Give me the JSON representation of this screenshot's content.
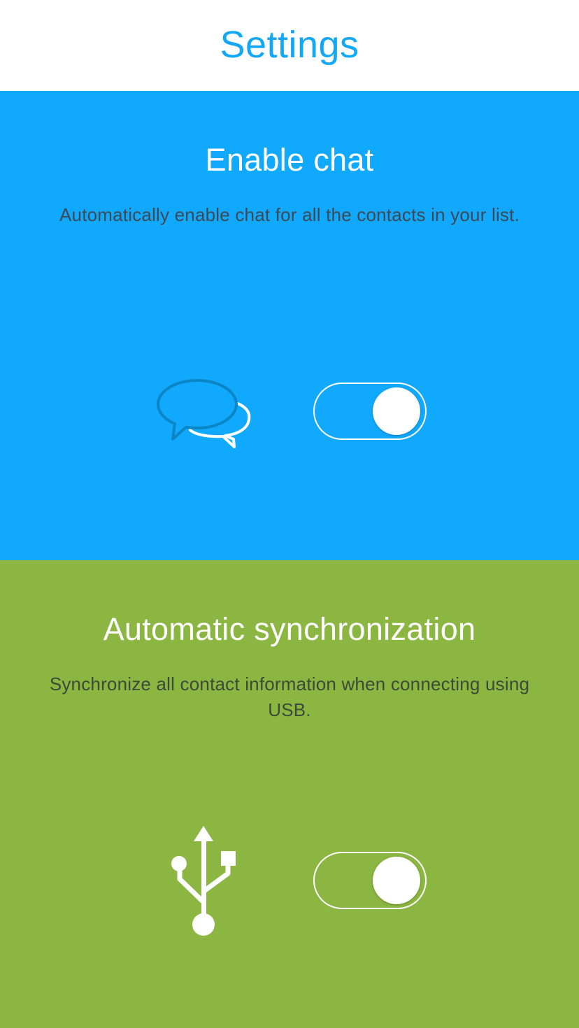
{
  "header": {
    "title": "Settings"
  },
  "colors": {
    "accent": "#13a8f7",
    "chat_section_bg": "#11a9fd",
    "sync_section_bg": "#8bb641",
    "header_bg": "#ffffff"
  },
  "sections": [
    {
      "title": "Enable chat",
      "description": "Automatically enable chat for all the contacts in your list.",
      "icon": "chat-bubbles-icon",
      "toggle": {
        "state": "on"
      }
    },
    {
      "title": "Automatic synchronization",
      "description": "Synchronize all contact information when connecting using USB.",
      "icon": "usb-icon",
      "toggle": {
        "state": "on"
      }
    }
  ]
}
